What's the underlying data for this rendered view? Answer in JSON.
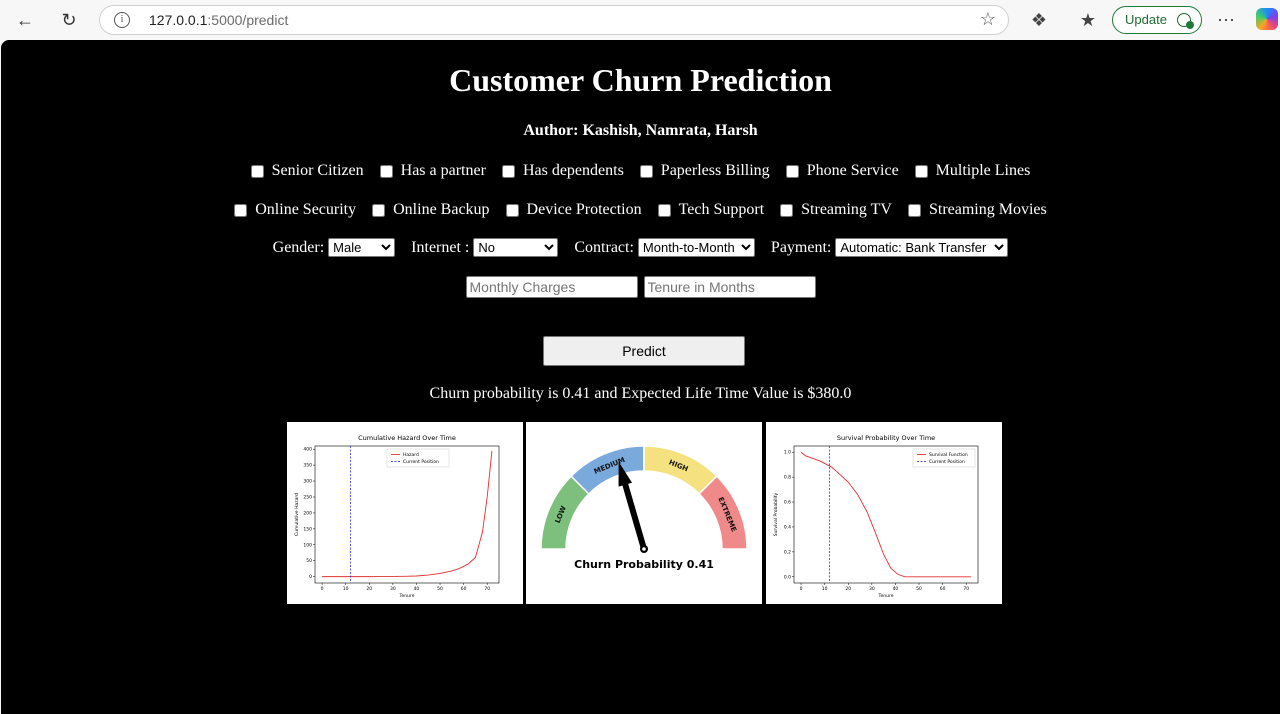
{
  "browser": {
    "url_host": "127.0.0.1",
    "url_path": ":5000/predict",
    "update_label": "Update"
  },
  "page": {
    "title": "Customer Churn Prediction",
    "author": "Author: Kashish, Namrata, Harsh"
  },
  "checkboxes_row1": [
    "Senior Citizen",
    "Has a partner",
    "Has dependents",
    "Paperless Billing",
    "Phone Service",
    "Multiple Lines"
  ],
  "checkboxes_row2": [
    "Online Security",
    "Online Backup",
    "Device Protection",
    "Tech Support",
    "Streaming TV",
    "Streaming Movies"
  ],
  "selects": {
    "gender": {
      "label": "Gender:",
      "value": "Male"
    },
    "internet": {
      "label": "Internet :",
      "value": "No"
    },
    "contract": {
      "label": "Contract:",
      "value": "Month-to-Month"
    },
    "payment": {
      "label": "Payment:",
      "value": "Automatic: Bank Transfer"
    }
  },
  "inputs": {
    "monthly_placeholder": "Monthly Charges",
    "tenure_placeholder": "Tenure in Months"
  },
  "predict_label": "Predict",
  "result_text": "Churn probability is 0.41 and Expected Life Time Value is $380.0",
  "chart_data": [
    {
      "type": "line",
      "title": "Cumulative Hazard Over Time",
      "xlabel": "Tenure",
      "ylabel": "Cumulative Hazard",
      "xlim": [
        -3,
        75
      ],
      "ylim": [
        -20,
        410
      ],
      "xticks": [
        0,
        10,
        20,
        30,
        40,
        50,
        60,
        70
      ],
      "yticks": [
        0,
        50,
        100,
        150,
        200,
        250,
        300,
        350,
        400
      ],
      "series": [
        {
          "name": "Hazard",
          "color": "#e03030",
          "style": "solid",
          "x": [
            0,
            10,
            20,
            30,
            35,
            40,
            45,
            50,
            55,
            58,
            62,
            65,
            68,
            70,
            72
          ],
          "y": [
            0,
            0,
            0,
            0.5,
            1,
            2,
            5,
            10,
            18,
            25,
            40,
            60,
            140,
            250,
            395
          ]
        }
      ],
      "vline": {
        "name": "Current Position",
        "x": 12,
        "color": "#1a1acc"
      },
      "legend": "top-center"
    },
    {
      "type": "gauge",
      "value": 0.41,
      "label": "Churn Probability 0.41",
      "segments": [
        {
          "name": "LOW",
          "color": "#7dbf7d"
        },
        {
          "name": "MEDIUM",
          "color": "#7aa9dc"
        },
        {
          "name": "HIGH",
          "color": "#f5e17f"
        },
        {
          "name": "EXTREME",
          "color": "#f08a8a"
        }
      ]
    },
    {
      "type": "line",
      "title": "Survival Probability Over Time",
      "xlabel": "Tenure",
      "ylabel": "Survival Probability",
      "xlim": [
        -3,
        75
      ],
      "ylim": [
        -0.05,
        1.05
      ],
      "xticks": [
        0,
        10,
        20,
        30,
        40,
        50,
        60,
        70
      ],
      "yticks": [
        0.0,
        0.2,
        0.4,
        0.6,
        0.8,
        1.0
      ],
      "series": [
        {
          "name": "Survival Function",
          "color": "#e03030",
          "style": "solid",
          "x": [
            0,
            2,
            5,
            8,
            10,
            13,
            16,
            20,
            24,
            28,
            32,
            35,
            38,
            41,
            44,
            48,
            55,
            65,
            72
          ],
          "y": [
            1.0,
            0.97,
            0.95,
            0.93,
            0.91,
            0.88,
            0.83,
            0.76,
            0.66,
            0.52,
            0.33,
            0.18,
            0.07,
            0.02,
            0.0,
            0.0,
            0.0,
            0.0,
            0.0
          ]
        }
      ],
      "vline": {
        "name": "Current Position",
        "x": 12,
        "color": "#1a1acc"
      },
      "legend": "top-right"
    }
  ]
}
